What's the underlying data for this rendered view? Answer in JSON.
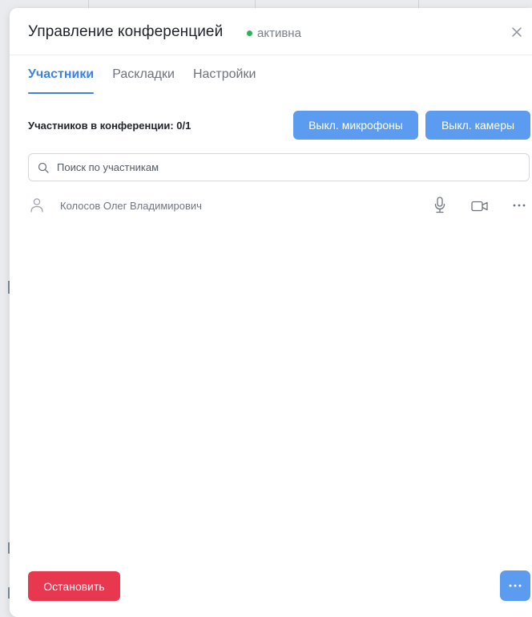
{
  "dialog": {
    "title": "Управление конференцией",
    "status": "активна"
  },
  "tabs": [
    {
      "label": "Участники",
      "active": true
    },
    {
      "label": "Раскладки",
      "active": false
    },
    {
      "label": "Настройки",
      "active": false
    }
  ],
  "participants_panel": {
    "count_label": "Участников в конференции: 0/1",
    "mute_mics_label": "Выкл. микрофоны",
    "disable_cams_label": "Выкл. камеры",
    "search_placeholder": "Поиск по участникам",
    "search_value": "",
    "participants": [
      {
        "name": "Колосов Олег Владимирович",
        "icons": [
          "microphone-icon",
          "camera-icon",
          "more-icon"
        ]
      }
    ]
  },
  "footer": {
    "stop_label": "Остановить",
    "more_icon": "more-icon"
  },
  "colors": {
    "accent": "#5b9cf1",
    "tab_active": "#3e82dd",
    "status_active": "#2fb05b",
    "danger": "#e8384f"
  }
}
